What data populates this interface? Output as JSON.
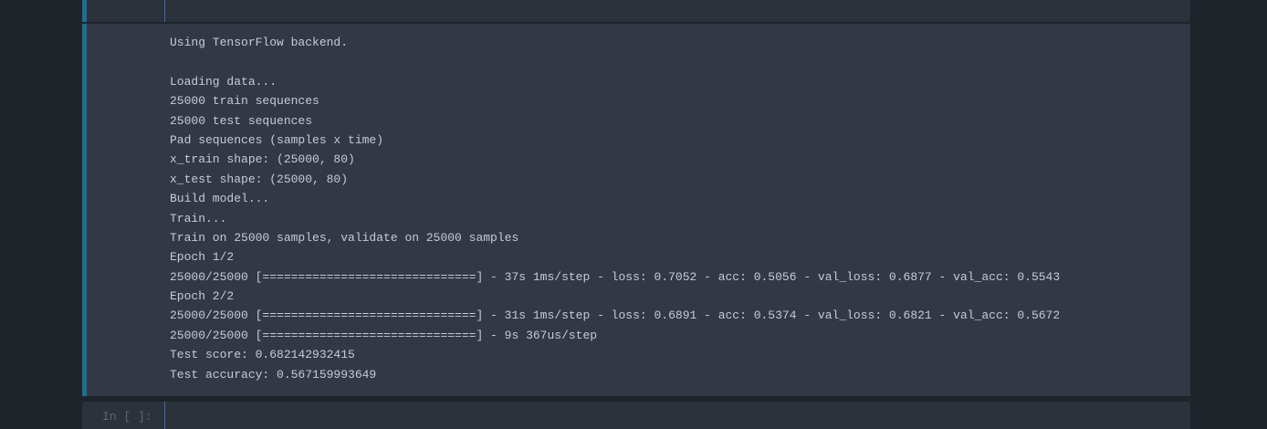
{
  "theme": {
    "page_bg": "#1f242b",
    "output_bg": "#323944",
    "cell_bg": "#2b323b",
    "accent": "#1f6f8f",
    "text": "#c6ccd6"
  },
  "output": {
    "lines": [
      "Using TensorFlow backend.",
      "",
      "Loading data...",
      "25000 train sequences",
      "25000 test sequences",
      "Pad sequences (samples x time)",
      "x_train shape: (25000, 80)",
      "x_test shape: (25000, 80)",
      "Build model...",
      "Train...",
      "Train on 25000 samples, validate on 25000 samples",
      "Epoch 1/2",
      "25000/25000 [==============================] - 37s 1ms/step - loss: 0.7052 - acc: 0.5056 - val_loss: 0.6877 - val_acc: 0.5543",
      "Epoch 2/2",
      "25000/25000 [==============================] - 31s 1ms/step - loss: 0.6891 - acc: 0.5374 - val_loss: 0.6821 - val_acc: 0.5672",
      "25000/25000 [==============================] - 9s 367us/step",
      "Test score: 0.682142932415",
      "Test accuracy: 0.567159993649"
    ]
  },
  "next_cell": {
    "prompt": "In [ ]:"
  }
}
